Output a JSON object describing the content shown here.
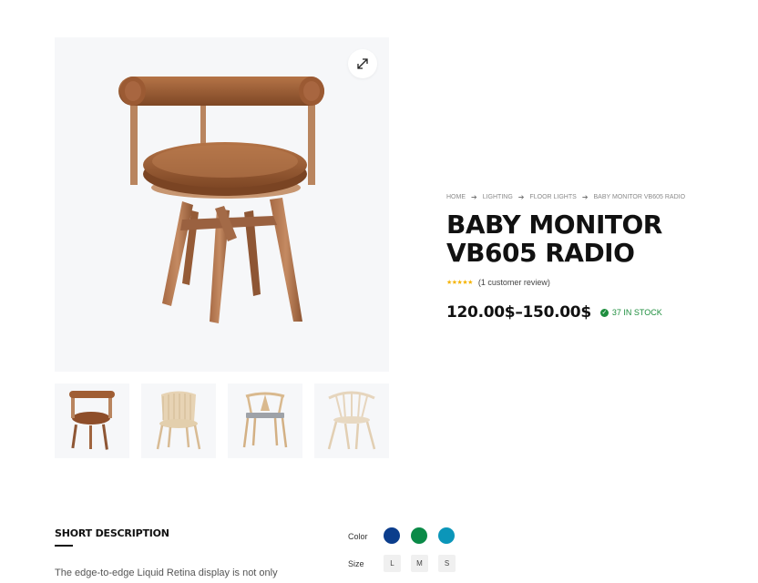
{
  "gallery": {
    "zoom_icon": "expand-icon",
    "thumbnails": [
      {
        "label": "leather swivel chair"
      },
      {
        "label": "rattan armchair"
      },
      {
        "label": "wishbone chair"
      },
      {
        "label": "spindle back chair"
      }
    ]
  },
  "breadcrumb": [
    "HOME",
    "LIGHTING",
    "FLOOR LIGHTS",
    "BABY MONITOR VB605 RADIO"
  ],
  "product": {
    "title_line1": "BABY MONITOR",
    "title_line2": "VB605 RADIO",
    "stars": "★★★★★",
    "review_text": "(1 customer review)",
    "price": "120.00$–150.00$",
    "stock_text": "37 IN STOCK"
  },
  "short_description": {
    "title": "SHORT DESCRIPTION",
    "text": "The edge-to-edge Liquid Retina display is not only"
  },
  "options": {
    "color_label": "Color",
    "colors": [
      "#0b3d8c",
      "#0a8a47",
      "#0b96b9"
    ],
    "size_label": "Size",
    "sizes": [
      "L",
      "M",
      "S"
    ]
  },
  "colors": {
    "accent_green": "#1e8e3e",
    "star_yellow": "#f5b301",
    "image_bg": "#f6f7f9"
  }
}
